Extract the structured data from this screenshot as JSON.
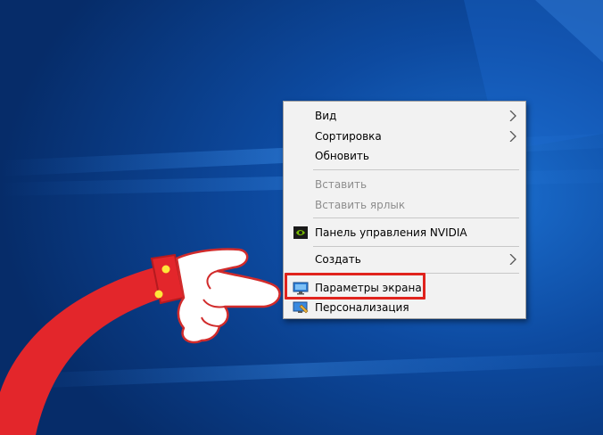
{
  "context_menu": {
    "items": [
      {
        "label": "Вид",
        "submenu": true
      },
      {
        "label": "Сортировка",
        "submenu": true
      },
      {
        "label": "Обновить"
      },
      {
        "label": "Вставить",
        "disabled": true
      },
      {
        "label": "Вставить ярлык",
        "disabled": true
      },
      {
        "label": "Панель управления NVIDIA",
        "icon": "nvidia-icon"
      },
      {
        "label": "Создать",
        "submenu": true
      },
      {
        "label": "Параметры экрана",
        "icon": "display-settings-icon",
        "highlighted": true
      },
      {
        "label": "Персонализация",
        "icon": "personalization-icon"
      }
    ]
  },
  "colors": {
    "desktop_blue": "#0a3d86",
    "menu_background": "#f2f2f2",
    "disabled_text": "#8d8d8d",
    "highlight_border": "#e0231d",
    "sleeve_red": "#e3262b",
    "button_yellow": "#ffe63a"
  },
  "icons": [
    "submenu-arrow-icon",
    "nvidia-icon",
    "display-settings-icon",
    "personalization-icon",
    "pointing-hand-icon"
  ]
}
